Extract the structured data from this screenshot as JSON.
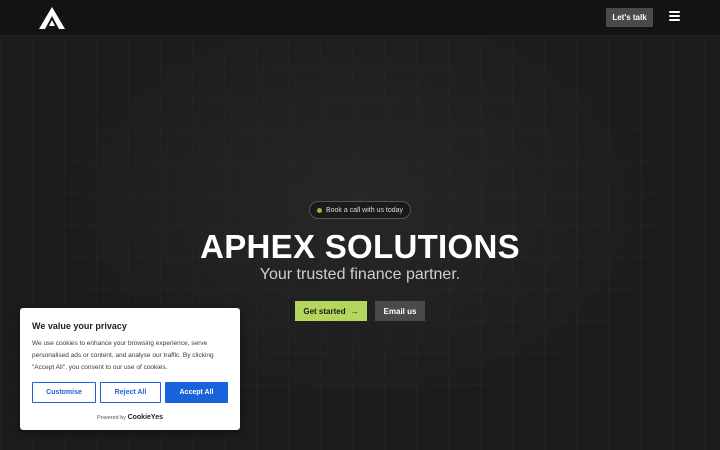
{
  "header": {
    "logo_name": "aphex-logo",
    "cta_label": "Let's talk",
    "menu_icon": "hamburger-icon"
  },
  "hero": {
    "pill_label": "Book a call with us today",
    "title": "APHEX SOLUTIONS",
    "subtitle": "Your trusted finance partner.",
    "primary_label": "Get started",
    "primary_icon": "→",
    "secondary_label": "Email us"
  },
  "cookie": {
    "title": "We value your privacy",
    "text": "We use cookies to enhance your browsing experience, serve personalised ads or content, and analyse our traffic. By clicking \"Accept All\", you consent to our use of cookies.",
    "customise_label": "Customise",
    "reject_label": "Reject All",
    "accept_label": "Accept All",
    "powered_prefix": "Powered by",
    "powered_brand": "CookieYes"
  },
  "colors": {
    "accent_green": "#b4d65c",
    "cookie_blue": "#1863dc",
    "background": "#1c1c1c"
  }
}
